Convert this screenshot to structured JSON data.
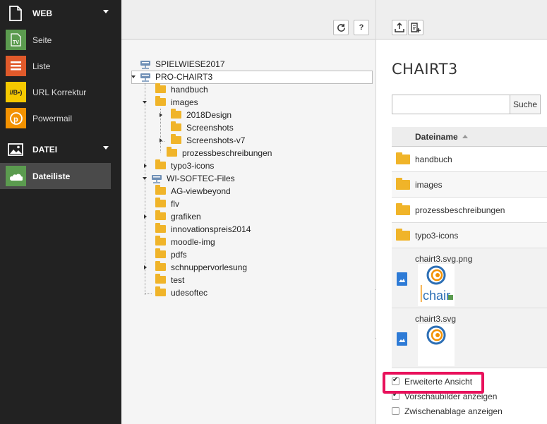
{
  "modules": {
    "groups": [
      {
        "label": "WEB",
        "icon": "page-icon"
      },
      {
        "label": "DATEI",
        "icon": "image-icon"
      }
    ],
    "web_items": [
      {
        "label": "Seite",
        "icon": "page-tv-icon",
        "color": "#5b9b4f"
      },
      {
        "label": "Liste",
        "icon": "list-icon",
        "color": "#e05a2b"
      },
      {
        "label": "URL Korrektur",
        "icon": "url-correction-icon",
        "color": "#f5c900"
      },
      {
        "label": "Powermail",
        "icon": "powermail-icon",
        "color": "#f39200"
      }
    ],
    "datei_items": [
      {
        "label": "Dateiliste",
        "icon": "filelist-icon",
        "color": "#5b9b4f",
        "active": true
      }
    ]
  },
  "tree_toolbar": {
    "refresh_icon": "refresh-icon",
    "help_label": "?"
  },
  "tree": {
    "nodes": [
      {
        "label": "SPIELWIESE2017",
        "type": "storage"
      },
      {
        "label": "PRO-CHAIRT3",
        "type": "storage",
        "selected": true
      },
      {
        "label": "handbuch",
        "type": "folder"
      },
      {
        "label": "images",
        "type": "folder"
      },
      {
        "label": "2018Design",
        "type": "folder"
      },
      {
        "label": "Screenshots",
        "type": "folder"
      },
      {
        "label": "Screenshots-v7",
        "type": "folder"
      },
      {
        "label": "prozessbeschreibungen",
        "type": "folder"
      },
      {
        "label": "typo3-icons",
        "type": "folder"
      },
      {
        "label": "WI-SOFTEC-Files",
        "type": "storage"
      },
      {
        "label": "AG-viewbeyond",
        "type": "folder"
      },
      {
        "label": "flv",
        "type": "folder"
      },
      {
        "label": "grafiken",
        "type": "folder"
      },
      {
        "label": "innovationspreis2014",
        "type": "folder"
      },
      {
        "label": "moodle-img",
        "type": "folder"
      },
      {
        "label": "pdfs",
        "type": "folder"
      },
      {
        "label": "schnuppervorlesung",
        "type": "folder"
      },
      {
        "label": "test",
        "type": "folder"
      },
      {
        "label": "udesoftec",
        "type": "folder"
      }
    ]
  },
  "content": {
    "title": "CHAIRT3",
    "search": {
      "placeholder": "",
      "button_label": "Suche"
    },
    "table": {
      "column_header": "Dateiname",
      "folders": [
        "handbuch",
        "images",
        "prozessbeschreibungen",
        "typo3-icons"
      ],
      "files": [
        {
          "name": "chairt3.svg.png",
          "thumb_text": "chair"
        },
        {
          "name": "chairt3.svg",
          "thumb_text": ""
        }
      ]
    },
    "options": [
      {
        "label": "Erweiterte Ansicht",
        "checked": true
      },
      {
        "label": "Vorschaubilder anzeigen",
        "checked": true
      },
      {
        "label": "Zwischenablage anzeigen",
        "checked": false
      }
    ]
  },
  "colors": {
    "sidebar_bg": "#222222",
    "highlight": "#e8115b",
    "folder": "#f0b429",
    "file_icon": "#2e7bd6"
  }
}
